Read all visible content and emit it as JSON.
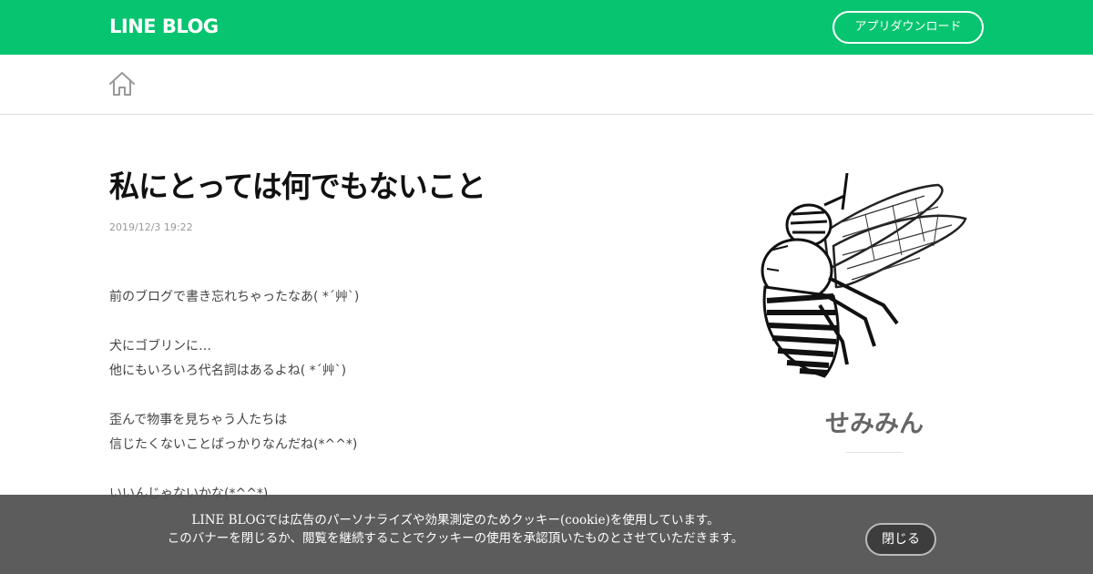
{
  "header": {
    "logo_text": "LINE BLOG",
    "app_download_label": "アプリダウンロード"
  },
  "nav": {
    "home_icon": "home-icon"
  },
  "article": {
    "title": "私にとっては何でもないこと",
    "date": "2019/12/3 19:22",
    "lines": [
      "前のブログで書き忘れちゃったなあ( *´艸`)",
      "",
      "犬にゴブリンに…",
      "他にもいろいろ代名詞はあるよね( *´艸`)",
      "",
      "歪んで物事を見ちゃう人たちは",
      "信じたくないことばっかりなんだね(*^^*)",
      "",
      "いいんじゃないかな(*^^*)"
    ]
  },
  "profile": {
    "avatar_icon": "bee-illustration",
    "name": "せみみん"
  },
  "cookie_banner": {
    "line1": "LINE BLOGでは広告のパーソナライズや効果測定のためクッキー(cookie)を使用しています。",
    "line2": "このバナーを閉じるか、閲覧を継続することでクッキーの使用を承認頂いたものとさせていただきます。",
    "close_label": "閉じる"
  },
  "colors": {
    "brand_green": "#06c46f",
    "banner_bg": "#505050"
  }
}
